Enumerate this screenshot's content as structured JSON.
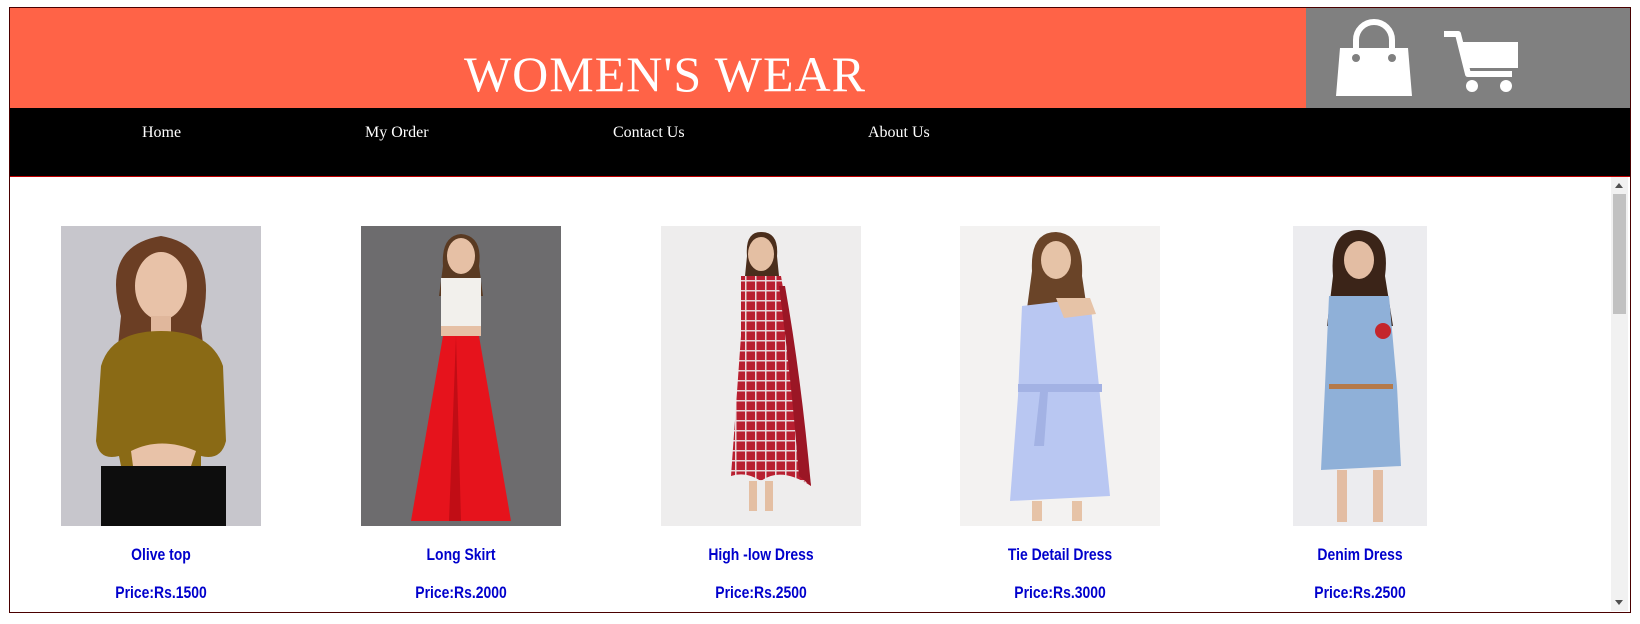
{
  "header": {
    "title": "WOMEN'S WEAR",
    "background": "#ff6347",
    "icons": [
      "shopping-bag-icon",
      "shopping-cart-icon"
    ]
  },
  "nav": {
    "items": [
      {
        "label": "Home"
      },
      {
        "label": "My Order"
      },
      {
        "label": "Contact Us"
      },
      {
        "label": "About Us"
      }
    ]
  },
  "products": [
    {
      "name": "Olive top",
      "price": "Price:Rs.1500"
    },
    {
      "name": "Long Skirt",
      "price": "Price:Rs.2000"
    },
    {
      "name": "High -low Dress",
      "price": "Price:Rs.2500"
    },
    {
      "name": "Tie Detail Dress",
      "price": "Price:Rs.3000"
    },
    {
      "name": "Denim Dress",
      "price": "Price:Rs.2500"
    }
  ],
  "colors": {
    "accent": "#ff6347",
    "icon_panel": "#808080",
    "nav_bg": "#000000",
    "product_text": "#0000cc"
  }
}
